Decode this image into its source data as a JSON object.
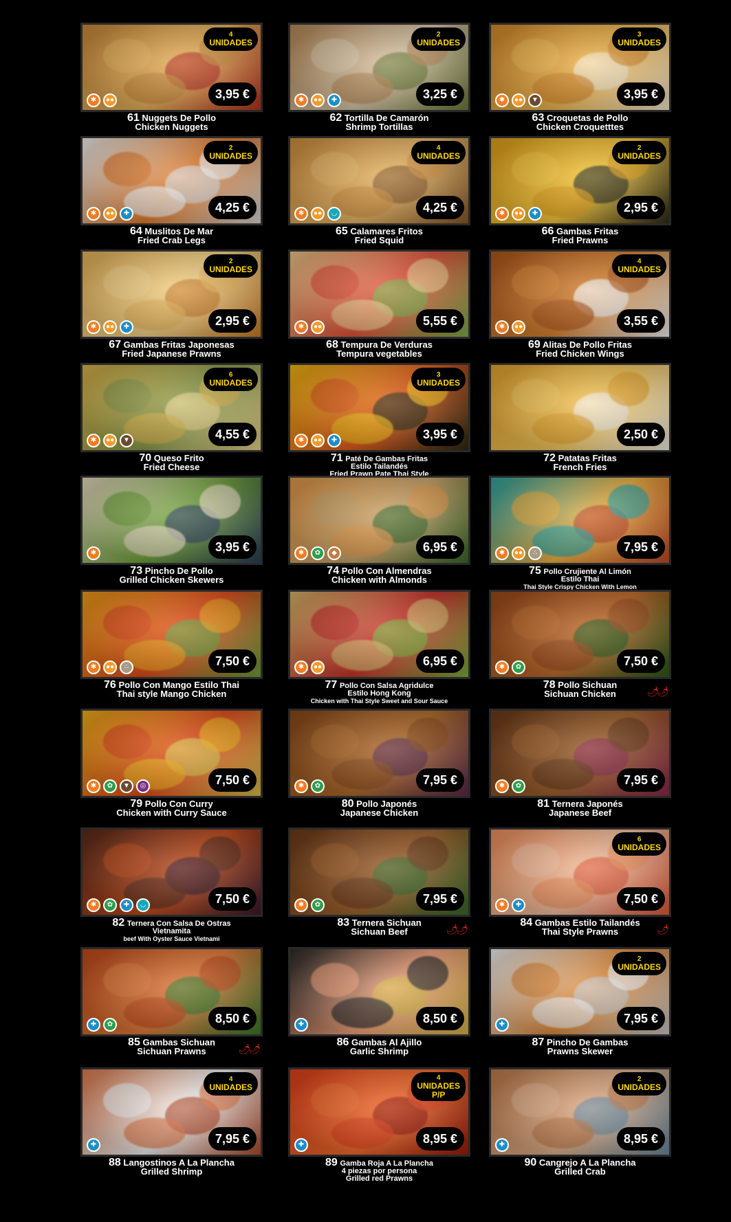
{
  "items": [
    {
      "num": "61",
      "es": "Nuggets De Pollo",
      "en": "Chicken Nuggets",
      "price": "3,95 €",
      "badge_qty": "4",
      "badge_unit": "UNIDADES",
      "allergens": [
        "gluten",
        "egg"
      ],
      "photo_colors": [
        "#c98a3b",
        "#e8b25a",
        "#b5311f"
      ]
    },
    {
      "num": "62",
      "es": "Tortilla De Camarón",
      "en": "Shrimp Tortillas",
      "price": "3,25 €",
      "badge_qty": "2",
      "badge_unit": "UNIDADES",
      "allergens": [
        "gluten",
        "egg",
        "crustacean"
      ],
      "photo_colors": [
        "#b88a58",
        "#d9c7a8",
        "#6e7a3a"
      ]
    },
    {
      "num": "63",
      "es": "Croquetas de Pollo",
      "en": "Chicken Croquetttes",
      "price": "3,95 €",
      "badge_qty": "3",
      "badge_unit": "UNIDADES",
      "allergens": [
        "gluten",
        "egg",
        "milk"
      ],
      "photo_colors": [
        "#d68a2a",
        "#f0b74e",
        "#f5e9cf"
      ]
    },
    {
      "num": "64",
      "es": "Muslitos De Mar",
      "en": "Fried Crab Legs",
      "price": "4,25 €",
      "badge_qty": "2",
      "badge_unit": "UNIDADES",
      "allergens": [
        "gluten",
        "egg",
        "crustacean"
      ],
      "photo_colors": [
        "#f3f3f3",
        "#e07a2a",
        "#d9d9d9"
      ]
    },
    {
      "num": "65",
      "es": "Calamares Fritos",
      "en": "Fried Squid",
      "price": "4,25 €",
      "badge_qty": "4",
      "badge_unit": "UNIDADES",
      "allergens": [
        "gluten",
        "egg",
        "mollusc"
      ],
      "photo_colors": [
        "#d1913f",
        "#e9b766",
        "#8a5a2a"
      ]
    },
    {
      "num": "66",
      "es": "Gambas Fritas",
      "en": "Fried Prawns",
      "price": "2,95 €",
      "badge_qty": "2",
      "badge_unit": "UNIDADES",
      "allergens": [
        "gluten",
        "egg",
        "crustacean"
      ],
      "photo_colors": [
        "#e2a21b",
        "#f5c63a",
        "#2b2b1a"
      ]
    },
    {
      "num": "67",
      "es": "Gambas Fritas Japonesas",
      "en": "Fried Japanese Prawns",
      "price": "2,95 €",
      "badge_qty": "2",
      "badge_unit": "UNIDADES",
      "allergens": [
        "gluten",
        "egg",
        "crustacean"
      ],
      "photo_colors": [
        "#e8b55a",
        "#f6d489",
        "#c97d2a"
      ]
    },
    {
      "num": "68",
      "es": "Tempura De Verduras",
      "en": "Tempura vegetables",
      "price": "5,55 €",
      "badge_qty": "",
      "badge_unit": "",
      "allergens": [
        "gluten",
        "egg"
      ],
      "photo_colors": [
        "#f0c98a",
        "#e2513a",
        "#7fb04a"
      ]
    },
    {
      "num": "69",
      "es": "Alitas De Pollo Fritas",
      "en": "Fried Chicken Wings",
      "price": "3,55 €",
      "badge_qty": "4",
      "badge_unit": "UNIDADES",
      "allergens": [
        "gluten",
        "egg"
      ],
      "photo_colors": [
        "#b0581c",
        "#d88432",
        "#f2f2f2"
      ]
    },
    {
      "num": "70",
      "es": "Queso Frito",
      "en": "Fried Cheese",
      "price": "4,55 €",
      "badge_qty": "6",
      "badge_unit": "UNIDADES",
      "allergens": [
        "gluten",
        "egg",
        "milk"
      ],
      "photo_colors": [
        "#d9b44a",
        "#8a9a4a",
        "#e8d38a"
      ]
    },
    {
      "num": "71",
      "es": "Paté De Gambas Fritas",
      "es2": "Estilo Tailandés",
      "en": "Fried Prawn Pate Thai Style",
      "price": "3,95 €",
      "badge_qty": "3",
      "badge_unit": "UNIDADES",
      "allergens": [
        "gluten",
        "egg",
        "crustacean"
      ],
      "photo_colors": [
        "#f2b814",
        "#e05a1a",
        "#2a2a12"
      ]
    },
    {
      "num": "72",
      "es": "Patatas Fritas",
      "en": "French Fries",
      "price": "2,50 €",
      "badge_qty": "",
      "badge_unit": "",
      "allergens": [],
      "photo_colors": [
        "#e6a52e",
        "#f5c75a",
        "#f3efe6"
      ]
    },
    {
      "num": "73",
      "es": "Pincho De Pollo",
      "en": "Grilled Chicken Skewers",
      "price": "3,95 €",
      "badge_qty": "",
      "badge_unit": "",
      "allergens": [
        "gluten"
      ],
      "photo_colors": [
        "#e9dcc2",
        "#6ea03a",
        "#2c3e5a"
      ]
    },
    {
      "num": "74",
      "es": "Pollo Con Almendras",
      "en": "Chicken with Almonds",
      "price": "6,95 €",
      "badge_qty": "",
      "badge_unit": "",
      "allergens": [
        "gluten",
        "soy",
        "nuts"
      ],
      "photo_colors": [
        "#e49a4a",
        "#c9a46a",
        "#3a6a2a"
      ]
    },
    {
      "num": "75",
      "es": "Pollo Crujiente Al Limón",
      "es2": "Estilo Thai",
      "en": "Thai Style Crispy Chicken With Lemon",
      "price": "7,95 €",
      "badge_qty": "",
      "badge_unit": "",
      "allergens": [
        "gluten",
        "egg",
        "sesame"
      ],
      "photo_colors": [
        "#2aa6a6",
        "#f0b040",
        "#c04a2a"
      ]
    },
    {
      "num": "76",
      "es": "Pollo Con Mango Estilo Thai",
      "en": "Thai style Mango Chicken",
      "price": "7,50 €",
      "badge_qty": "",
      "badge_unit": "",
      "allergens": [
        "gluten",
        "egg",
        "sesame"
      ],
      "photo_colors": [
        "#f0a01a",
        "#e04a1a",
        "#6aa03a"
      ]
    },
    {
      "num": "77",
      "es": "Pollo Con Salsa Agridulce",
      "es2": "Estilo Hong Kong",
      "en": "Chicken with Thai Style Sweet and Sour Sauce",
      "price": "6,95 €",
      "badge_qty": "",
      "badge_unit": "",
      "allergens": [
        "gluten",
        "egg"
      ],
      "photo_colors": [
        "#d9b86a",
        "#c9302a",
        "#7ab03a"
      ]
    },
    {
      "num": "78",
      "es": "Pollo Sichuan",
      "en": "Sichuan Chicken",
      "price": "7,50 €",
      "badge_qty": "",
      "badge_unit": "",
      "allergens": [
        "gluten",
        "soy"
      ],
      "photo_colors": [
        "#9a4a1a",
        "#c06a2a",
        "#2a5a1a"
      ],
      "spicy": "🌶🌶"
    },
    {
      "num": "79",
      "es": "Pollo Con Curry",
      "en": "Chicken with Curry Sauce",
      "price": "7,50 €",
      "badge_qty": "",
      "badge_unit": "",
      "allergens": [
        "gluten",
        "soy",
        "milk",
        "sulfite"
      ],
      "photo_colors": [
        "#f2b01a",
        "#e04a1a",
        "#d9c24a"
      ]
    },
    {
      "num": "80",
      "es": "Pollo Japonés",
      "en": "Japanese Chicken",
      "price": "7,95 €",
      "badge_qty": "",
      "badge_unit": "",
      "allergens": [
        "gluten",
        "soy"
      ],
      "photo_colors": [
        "#8a4a1a",
        "#b06a2a",
        "#5a2a4a"
      ]
    },
    {
      "num": "81",
      "es": "Ternera Japonés",
      "en": "Japanese Beef",
      "price": "7,95 €",
      "badge_qty": "",
      "badge_unit": "",
      "allergens": [
        "gluten",
        "soy"
      ],
      "photo_colors": [
        "#6a3a1a",
        "#a0602a",
        "#8a2a4a"
      ]
    },
    {
      "num": "82",
      "es": "Ternera Con Salsa De Ostras",
      "es2": "Vietnamita",
      "en": "beef With Oyster Sauce Vietnami",
      "price": "7,50 €",
      "badge_qty": "",
      "badge_unit": "",
      "allergens": [
        "gluten",
        "soy",
        "crustacean",
        "mollusc"
      ],
      "photo_colors": [
        "#5a2a1a",
        "#c04a1a",
        "#3a1a2a"
      ]
    },
    {
      "num": "83",
      "es": "Ternera Sichuan",
      "en": "Sichuan Beef",
      "price": "7,95 €",
      "badge_qty": "",
      "badge_unit": "",
      "allergens": [
        "gluten",
        "soy"
      ],
      "photo_colors": [
        "#6a3a1a",
        "#a0602a",
        "#3a6a2a"
      ],
      "spicy": "🌶🌶"
    },
    {
      "num": "84",
      "es": "Gambas Estilo Tailandés",
      "en": "Thai Style Prawns",
      "price": "7,50 €",
      "badge_qty": "6",
      "badge_unit": "UNIDADES",
      "allergens": [
        "gluten",
        "crustacean"
      ],
      "photo_colors": [
        "#f0905a",
        "#f5c0a0",
        "#e05a3a"
      ],
      "spicy": "🌶"
    },
    {
      "num": "85",
      "es": "Gambas Sichuan",
      "en": "Sichuan Prawns",
      "price": "8,50 €",
      "badge_qty": "",
      "badge_unit": "",
      "allergens": [
        "crustacean",
        "soy"
      ],
      "photo_colors": [
        "#c04a1a",
        "#e07a3a",
        "#3a7a2a"
      ],
      "spicy": "🌶🌶"
    },
    {
      "num": "86",
      "es": "Gambas Al Ajillo",
      "en": "Garlic Shrimp",
      "price": "8,50 €",
      "badge_qty": "",
      "badge_unit": "",
      "allergens": [
        "crustacean"
      ],
      "photo_colors": [
        "#2a2a2a",
        "#f0a07a",
        "#d9b84a"
      ]
    },
    {
      "num": "87",
      "es": "Pincho De Gambas",
      "en": "Prawns Skewer",
      "price": "7,95 €",
      "badge_qty": "2",
      "badge_unit": "UNIDADES",
      "allergens": [
        "crustacean"
      ],
      "photo_colors": [
        "#f2f2f2",
        "#e08a3a",
        "#c9c9c9"
      ]
    },
    {
      "num": "88",
      "es": "Langostinos A La Plancha",
      "en": "Grilled Shrimp",
      "price": "7,95 €",
      "badge_qty": "4",
      "badge_unit": "UNIDADES",
      "allergens": [
        "crustacean"
      ],
      "photo_colors": [
        "#e07a4a",
        "#f0f0f0",
        "#b04a2a"
      ]
    },
    {
      "num": "89",
      "es": "Gamba Roja A La Plancha",
      "es2": "4 piezas por persona",
      "en": "Grilled red Prawns",
      "price": "8,95 €",
      "badge_qty": "4",
      "badge_unit": "UNIDADES",
      "badge_unit2": "P/P",
      "allergens": [
        "crustacean"
      ],
      "photo_colors": [
        "#e0401a",
        "#f06a2a",
        "#9a1a0a"
      ]
    },
    {
      "num": "90",
      "es": "Cangrejo A La Plancha",
      "en": "Grilled Crab",
      "price": "8,95 €",
      "badge_qty": "2",
      "badge_unit": "UNIDADES",
      "allergens": [
        "crustacean"
      ],
      "photo_colors": [
        "#c07a4a",
        "#e0b08a",
        "#6a8aa0"
      ]
    }
  ],
  "allergen_icons": {
    "gluten": "gluten-icon",
    "egg": "egg-icon",
    "crustacean": "crab-icon",
    "mollusc": "shell-icon",
    "soy": "soy-icon",
    "nuts": "nuts-icon",
    "milk": "milk-icon",
    "sesame": "sesame-icon",
    "sulfite": "sulfite-icon"
  }
}
